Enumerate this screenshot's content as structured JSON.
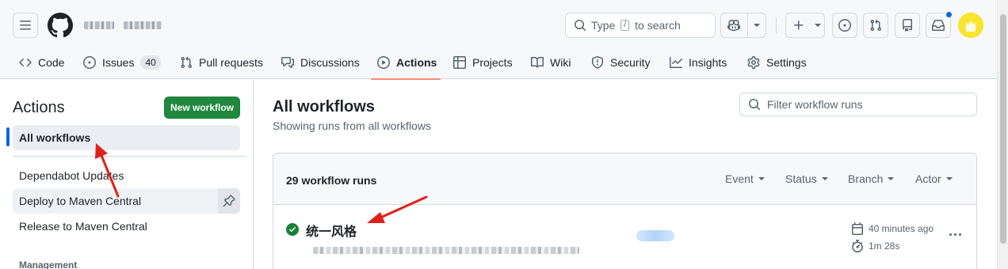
{
  "header": {
    "repo_owner_redacted": "▒▒▒",
    "repo_name_redacted": "▒▒▒",
    "search": {
      "prefix": "Type",
      "key": "/",
      "suffix": "to search"
    }
  },
  "tabs": [
    {
      "label": "Code",
      "icon": "code-icon"
    },
    {
      "label": "Issues",
      "icon": "issue-icon",
      "count": "40"
    },
    {
      "label": "Pull requests",
      "icon": "pull-request-icon"
    },
    {
      "label": "Discussions",
      "icon": "discussions-icon"
    },
    {
      "label": "Actions",
      "icon": "play-icon",
      "active": true
    },
    {
      "label": "Projects",
      "icon": "table-icon"
    },
    {
      "label": "Wiki",
      "icon": "book-icon"
    },
    {
      "label": "Security",
      "icon": "shield-icon"
    },
    {
      "label": "Insights",
      "icon": "graph-icon"
    },
    {
      "label": "Settings",
      "icon": "gear-icon"
    }
  ],
  "sidebar": {
    "title": "Actions",
    "new_workflow_label": "New workflow",
    "items": [
      {
        "label": "All workflows",
        "selected": true
      },
      {
        "label": "Dependabot Updates"
      },
      {
        "label": "Deploy to Maven Central"
      },
      {
        "label": "Release to Maven Central"
      }
    ],
    "section_label": "Management"
  },
  "main": {
    "title": "All workflows",
    "subtitle": "Showing runs from all workflows",
    "filter_placeholder": "Filter workflow runs",
    "runs_count": "29 workflow runs",
    "filters": [
      "Event",
      "Status",
      "Branch",
      "Actor"
    ],
    "runs": [
      {
        "title": "统一风格",
        "status": "success",
        "time_ago": "40 minutes ago",
        "duration": "1m 28s"
      }
    ]
  },
  "colors": {
    "accent_blue": "#0969da",
    "primary_green": "#1f883d",
    "tab_underline": "#fd8c73",
    "success_green": "#1a7f37",
    "annotation_red": "#e0201b"
  }
}
